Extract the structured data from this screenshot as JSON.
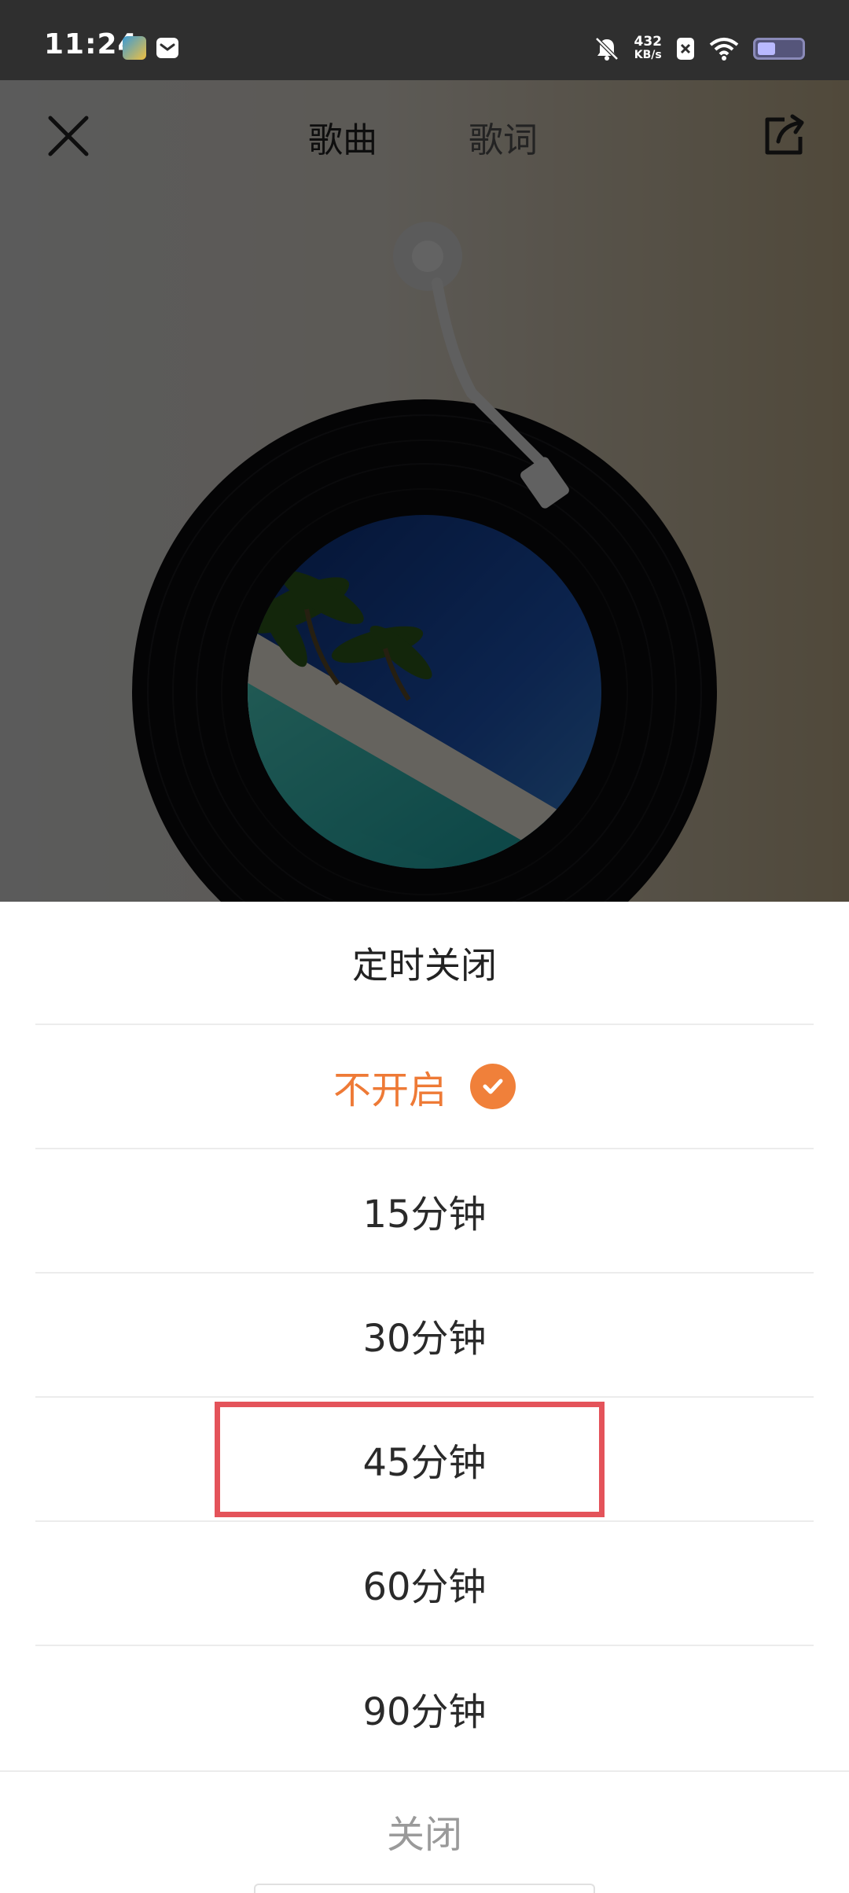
{
  "status_bar": {
    "time": "11:24",
    "net_speed_value": "432",
    "net_speed_unit": "KB/s"
  },
  "player": {
    "tabs": [
      {
        "label": "歌曲",
        "active": true
      },
      {
        "label": "歌词",
        "active": false
      }
    ],
    "icons": {
      "close": "close-icon",
      "share": "share-icon"
    }
  },
  "sleep_timer": {
    "title": "定时关闭",
    "options": [
      {
        "label": "不开启",
        "selected": true
      },
      {
        "label": "15分钟",
        "selected": false
      },
      {
        "label": "30分钟",
        "selected": false
      },
      {
        "label": "45分钟",
        "selected": false,
        "highlighted": true
      },
      {
        "label": "60分钟",
        "selected": false
      },
      {
        "label": "90分钟",
        "selected": false
      }
    ],
    "close_label": "关闭"
  },
  "colors": {
    "accent": "#ee7a36",
    "highlight_border": "#e4535a"
  }
}
